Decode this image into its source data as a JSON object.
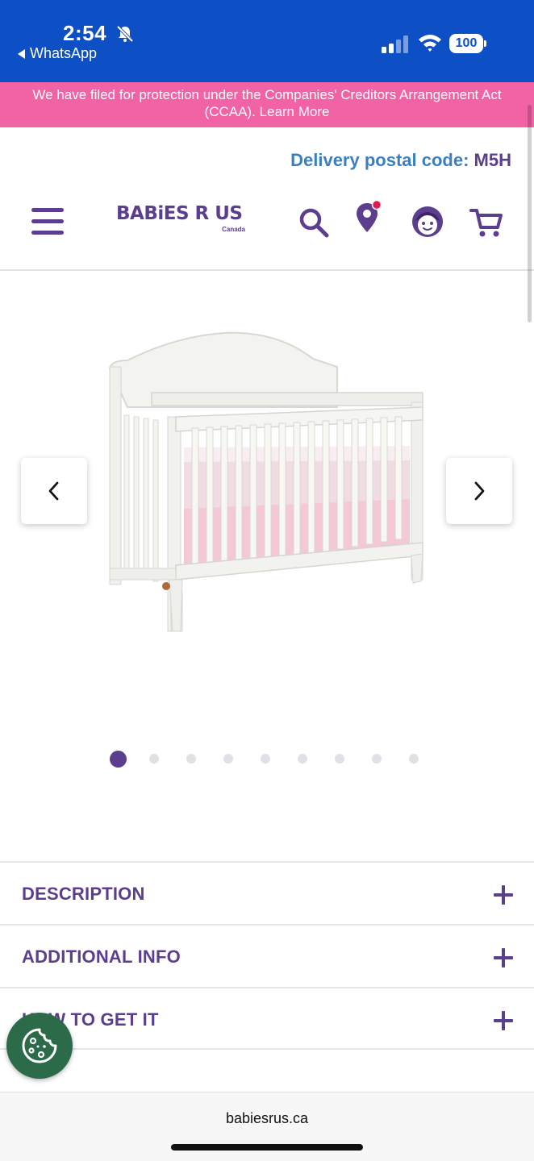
{
  "status_bar": {
    "time": "2:54",
    "back_app": "WhatsApp",
    "battery": "100",
    "background_color": "#0d4fc4"
  },
  "notice": {
    "text": "We have filed for protection under the Companies' Creditors Arrangement Act (CCAA). Learn More",
    "background_color": "#f263a6"
  },
  "delivery": {
    "label": "Delivery postal code:",
    "code": "M5H"
  },
  "header": {
    "logo_text": "BABiES R US",
    "logo_sub": "Canada",
    "icons": [
      "menu-icon",
      "search-icon",
      "location-pin-icon",
      "account-face-icon",
      "cart-icon"
    ]
  },
  "gallery": {
    "image_count": 9,
    "active_index": 0
  },
  "accordions": [
    {
      "label": "DESCRIPTION"
    },
    {
      "label": "ADDITIONAL INFO"
    },
    {
      "label": "HOW TO GET IT"
    }
  ],
  "browser": {
    "url": "babiesrus.ca"
  },
  "colors": {
    "brand_purple": "#5b3e8e",
    "delivery_blue": "#3c7fc0",
    "cookie_green": "#2b6b4a"
  }
}
